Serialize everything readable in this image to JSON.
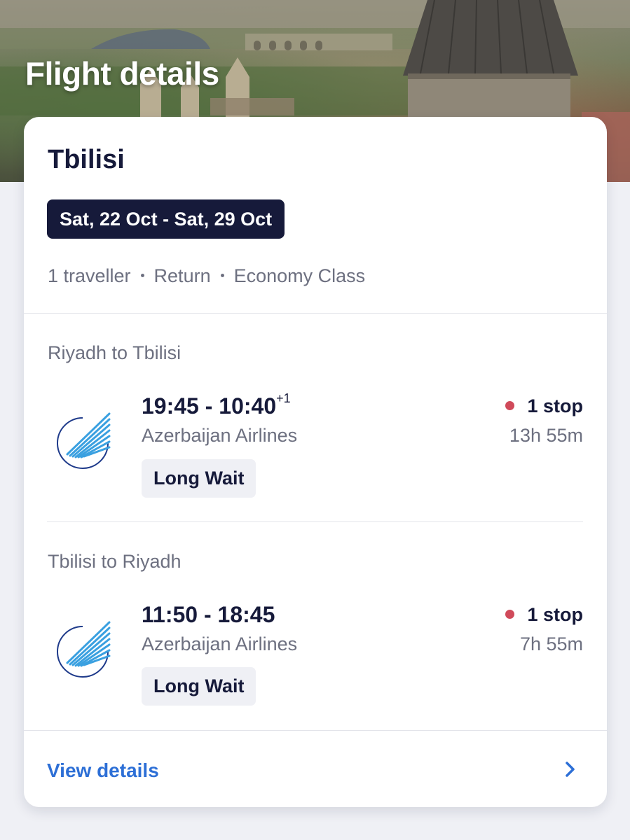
{
  "header": {
    "title": "Flight details"
  },
  "trip": {
    "destination": "Tbilisi",
    "dates": "Sat, 22 Oct - Sat, 29 Oct",
    "travellers": "1 traveller",
    "trip_type": "Return",
    "cabin_class": "Economy Class"
  },
  "legs": [
    {
      "title": "Riyadh to Tbilisi",
      "times": "19:45 - 10:40",
      "day_offset": "+1",
      "airline": "Azerbaijan Airlines",
      "badge": "Long Wait",
      "stops": "1 stop",
      "duration": "13h 55m"
    },
    {
      "title": "Tbilisi to Riyadh",
      "times": "11:50 - 18:45",
      "day_offset": "",
      "airline": "Azerbaijan Airlines",
      "badge": "Long Wait",
      "stops": "1 stop",
      "duration": "7h 55m"
    }
  ],
  "footer": {
    "view_details": "View details",
    "chevron_icon": "chevron-right-icon"
  },
  "colors": {
    "navy": "#161a3a",
    "muted": "#6d7080",
    "link_blue": "#2d6fd6",
    "stop_dot": "#d04a5a",
    "badge_bg": "#eff0f5",
    "page_bg": "#eff0f5"
  },
  "icons": {
    "airline_logo": "azerbaijan-airlines-logo",
    "stop_indicator": "stop-dot-icon"
  }
}
